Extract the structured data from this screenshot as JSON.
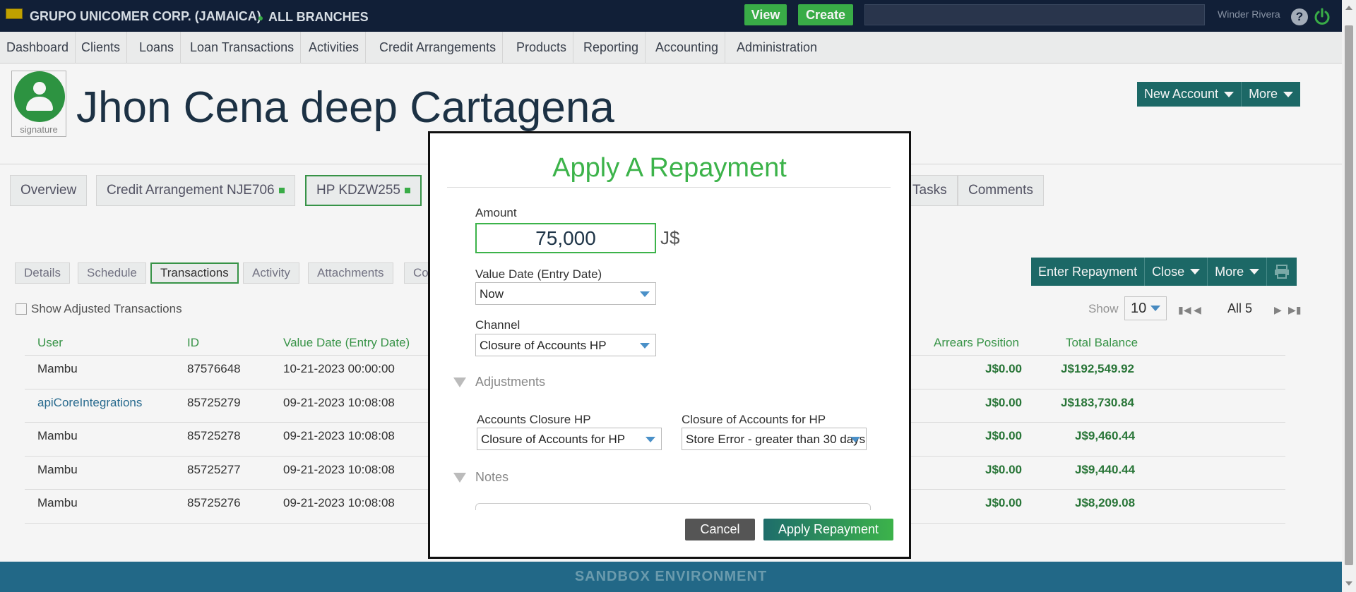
{
  "topbar": {
    "org_name": "GRUPO UNICOMER CORP. (JAMAICA)",
    "branch": "ALL BRANCHES",
    "view_label": "View",
    "create_label": "Create",
    "search_placeholder": "",
    "user_name": "Winder Rivera",
    "help_glyph": "?"
  },
  "nav": {
    "items": [
      "Dashboard",
      "Clients",
      "Loans",
      "Loan Transactions",
      "Activities",
      "Credit Arrangements",
      "Products",
      "Reporting",
      "Accounting",
      "Administration"
    ]
  },
  "client": {
    "signature_label": "signature",
    "name": "Jhon Cena deep Cartagena",
    "new_account_label": "New Account",
    "more_label": "More"
  },
  "tabs": {
    "overview": "Overview",
    "credit_arrangement": "Credit Arrangement NJE706",
    "hp": "HP KDZW255",
    "tasks": "Tasks",
    "comments": "Comments"
  },
  "subtabs": {
    "details": "Details",
    "schedule": "Schedule",
    "transactions": "Transactions",
    "activity": "Activity",
    "attachments": "Attachments",
    "comments_partial": "Co"
  },
  "transactions": {
    "show_adjusted_label": "Show Adjusted Transactions",
    "enter_repayment_label": "Enter Repayment",
    "close_label": "Close",
    "more_label": "More",
    "show_label": "Show",
    "page_size": "10",
    "all_label": "All 5",
    "columns": {
      "user": "User",
      "id": "ID",
      "value_date": "Value Date (Entry Date)",
      "arrears": "Arrears Position",
      "total_balance": "Total Balance"
    },
    "rows": [
      {
        "user": "Mambu",
        "id": "87576648",
        "date": "10-21-2023 00:00:00",
        "arrears": "J$0.00",
        "balance": "J$192,549.92"
      },
      {
        "user": "apiCoreIntegrations",
        "id": "85725279",
        "date": "09-21-2023 10:08:08",
        "arrears": "J$0.00",
        "balance": "J$183,730.84"
      },
      {
        "user": "Mambu",
        "id": "85725278",
        "date": "09-21-2023 10:08:08",
        "arrears": "J$0.00",
        "balance": "J$9,460.44"
      },
      {
        "user": "Mambu",
        "id": "85725277",
        "date": "09-21-2023 10:08:08",
        "arrears": "J$0.00",
        "balance": "J$9,440.44"
      },
      {
        "user": "Mambu",
        "id": "85725276",
        "date": "09-21-2023 10:08:08",
        "arrears": "J$0.00",
        "balance": "J$8,209.08"
      }
    ]
  },
  "footer": {
    "label": "SANDBOX ENVIRONMENT"
  },
  "modal": {
    "title": "Apply A Repayment",
    "amount_label": "Amount",
    "amount_value": "75,000",
    "currency": "J$",
    "value_date_label": "Value Date (Entry Date)",
    "value_date_value": "Now",
    "channel_label": "Channel",
    "channel_value": "Closure of Accounts HP",
    "adjustments_label": "Adjustments",
    "accounts_closure_label": "Accounts Closure HP",
    "accounts_closure_value": "Closure of Accounts for HP",
    "closure_for_hp_label": "Closure of Accounts for HP",
    "closure_for_hp_value": "Store Error - greater than 30 days",
    "notes_label": "Notes",
    "cancel_label": "Cancel",
    "apply_label": "Apply Repayment"
  },
  "colors": {
    "accent_green": "#3cb34a",
    "teal": "#1e6d6b",
    "topbar": "#12213a",
    "footer": "#246d8d"
  }
}
